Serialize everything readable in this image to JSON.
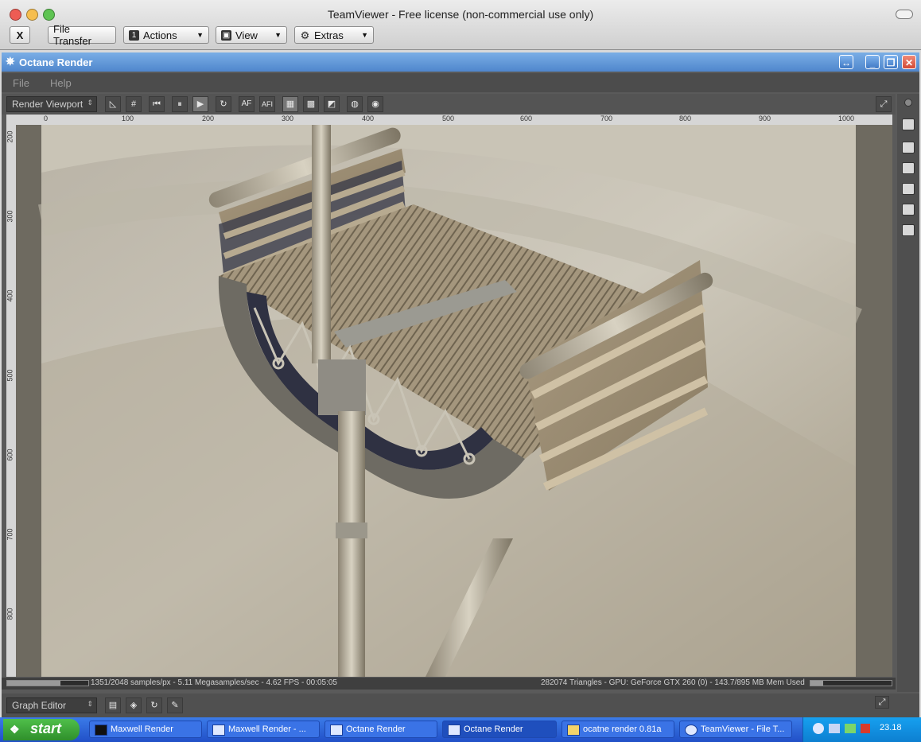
{
  "teamviewer": {
    "title": "TeamViewer - Free license (non-commercial use only)",
    "close_label": "X",
    "file_transfer_label": "File Transfer",
    "actions_label": "Actions",
    "view_label": "View",
    "extras_label": "Extras"
  },
  "octane": {
    "title": "Octane Render",
    "menu": [
      "File",
      "Help"
    ],
    "viewport_mode": "Render Viewport",
    "toolbar_af": "AF",
    "toolbar_afi": "AFI",
    "ruler_top": [
      "0",
      "100",
      "200",
      "300",
      "400",
      "500",
      "600",
      "700",
      "800",
      "900",
      "1000"
    ],
    "ruler_left": [
      "200",
      "300",
      "400",
      "500",
      "600",
      "700",
      "800"
    ],
    "status_left": "1351/2048 samples/px - 5.11 Megasamples/sec - 4.62 FPS - 00:05:05",
    "status_right": "282074 Triangles - GPU: GeForce GTX 260 (0) - 143.7/895 MB Mem Used",
    "sample_progress": 0.66,
    "mem_progress": 0.16,
    "graph_editor_label": "Graph Editor"
  },
  "taskbar": {
    "start_label": "start",
    "tasks": [
      {
        "label": "Maxwell Render"
      },
      {
        "label": "Maxwell Render - ..."
      },
      {
        "label": "Octane Render"
      },
      {
        "label": "Octane Render"
      },
      {
        "label": "ocatne render 0.81a"
      },
      {
        "label": "TeamViewer - File T..."
      }
    ],
    "language": "IT",
    "clock": "23.18"
  },
  "colors": {
    "accent": "#4f86cc",
    "taskbar": "#2150c7",
    "start": "#2f8f2b"
  }
}
